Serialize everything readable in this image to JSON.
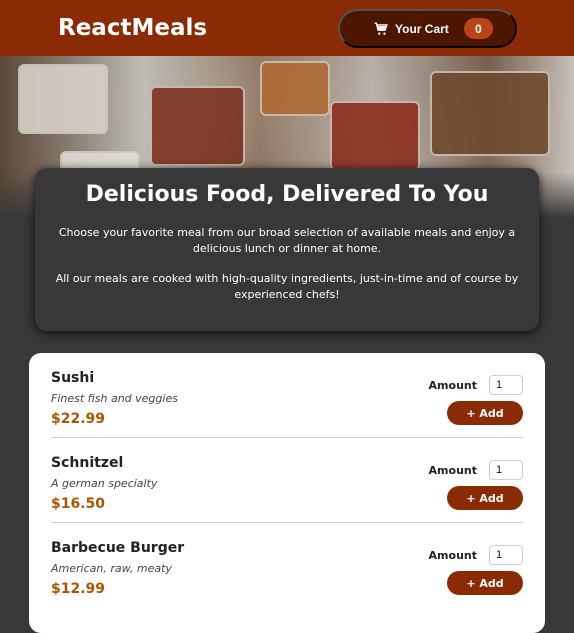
{
  "header": {
    "title": "ReactMeals",
    "cart_label": "Your Cart",
    "cart_count": "0",
    "cart_icon": "cart-icon"
  },
  "colors": {
    "brand": "#8a2b06",
    "cart_button": "#4d1601",
    "badge": "#b94517",
    "price": "#ad5502",
    "background": "#383838"
  },
  "summary": {
    "title": "Delicious Food, Delivered To You",
    "p1": "Choose your favorite meal from our broad selection of available meals and enjoy a delicious lunch or dinner at home.",
    "p2": "All our meals are cooked with high-quality ingredients, just-in-time and of course by experienced chefs!"
  },
  "meals": [
    {
      "name": "Sushi",
      "description": "Finest fish and veggies",
      "price": "$22.99",
      "amount_label": "Amount",
      "amount": "1",
      "add_label": "+ Add"
    },
    {
      "name": "Schnitzel",
      "description": "A german specialty",
      "price": "$16.50",
      "amount_label": "Amount",
      "amount": "1",
      "add_label": "+ Add"
    },
    {
      "name": "Barbecue Burger",
      "description": "American, raw, meaty",
      "price": "$12.99",
      "amount_label": "Amount",
      "amount": "1",
      "add_label": "+ Add"
    }
  ]
}
